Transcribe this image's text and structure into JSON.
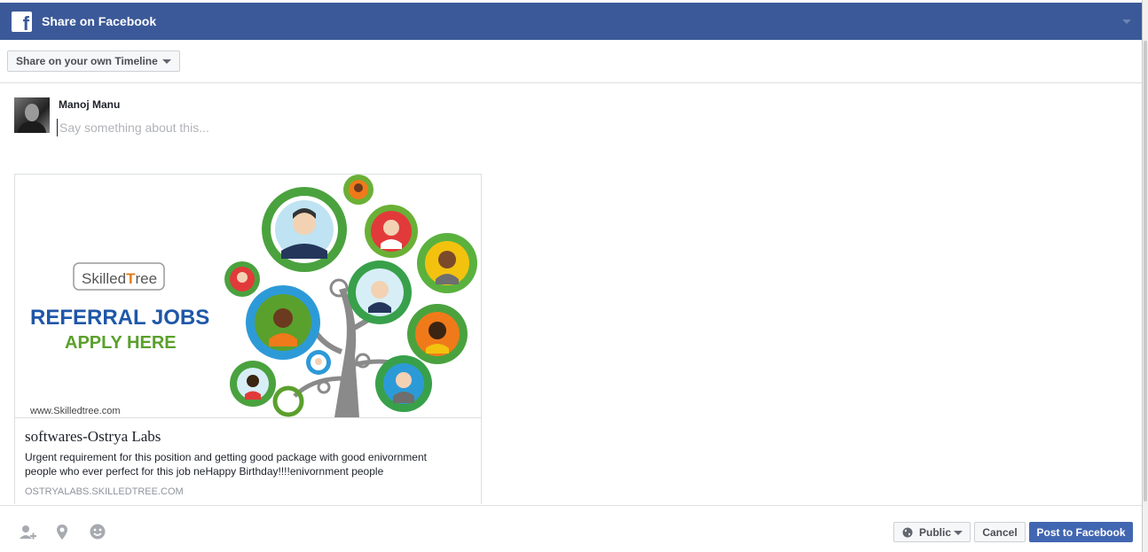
{
  "header": {
    "title": "Share on Facebook",
    "logo_letter": "f"
  },
  "target_selector": {
    "label": "Share on your own Timeline"
  },
  "composer": {
    "user_name": "Manoj Manu",
    "placeholder": "Say something about this..."
  },
  "link_card": {
    "image": {
      "brand": "Skilled tree",
      "brand_part1": "Skilled",
      "brand_part2": "ree",
      "headline": "REFERRAL JOBS",
      "subheadline": "APPLY HERE",
      "website": "www.Skilledtree.com"
    },
    "title": "softwares-Ostrya Labs",
    "description": "Urgent requirement for this position and getting good package with good enivornment people who ever perfect for this job neHappy Birthday!!!!enivornment people",
    "domain": "OSTRYALABS.SKILLEDTREE.COM"
  },
  "footer": {
    "tools": [
      {
        "icon": "tag-friends-icon"
      },
      {
        "icon": "location-pin-icon"
      },
      {
        "icon": "feeling-emoji-icon"
      }
    ],
    "privacy_label": "Public",
    "cancel_label": "Cancel",
    "post_label": "Post to Facebook"
  },
  "colors": {
    "header_bg": "#3b5998",
    "primary_button": "#4267b2",
    "headline_blue": "#1f57a8",
    "subheadline_green": "#5aa02c"
  }
}
